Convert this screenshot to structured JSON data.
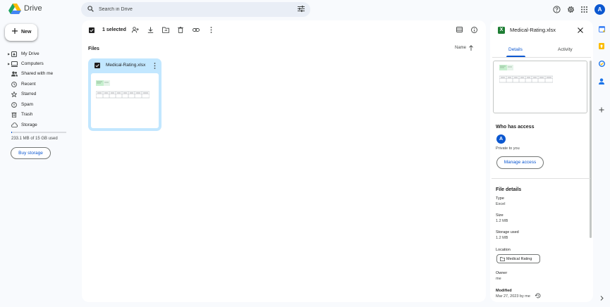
{
  "app": {
    "title": "Drive"
  },
  "search": {
    "placeholder": "Search in Drive"
  },
  "header": {
    "account_initial": "A"
  },
  "sidebar": {
    "new_label": "New",
    "items": [
      {
        "label": "My Drive",
        "icon": "my-drive-icon",
        "expandable": true
      },
      {
        "label": "Computers",
        "icon": "computer-icon",
        "expandable": true
      },
      {
        "label": "Shared with me",
        "icon": "people-icon",
        "expandable": false
      },
      {
        "label": "Recent",
        "icon": "clock-icon",
        "expandable": false
      },
      {
        "label": "Starred",
        "icon": "star-icon",
        "expandable": false
      },
      {
        "label": "Spam",
        "icon": "spam-icon",
        "expandable": false
      },
      {
        "label": "Trash",
        "icon": "trash-icon",
        "expandable": false
      },
      {
        "label": "Storage",
        "icon": "cloud-icon",
        "expandable": false
      }
    ],
    "storage_text": "233.1 MB of 15 GB used",
    "storage_fraction": 0.015,
    "buy_storage_label": "Buy storage"
  },
  "toolbar": {
    "selected_label": "1 selected"
  },
  "main": {
    "section_title": "Files",
    "sort_label": "Name",
    "files": [
      {
        "name": "Medical-Rating.xlsx",
        "selected": true
      }
    ]
  },
  "details": {
    "title": "Medical-Rating.xlsx",
    "file_type_badge": "X",
    "tabs": [
      "Details",
      "Activity"
    ],
    "active_tab": "Details",
    "access_heading": "Who has access",
    "access_avatar_initial": "A",
    "access_text": "Private to you",
    "manage_access_label": "Manage access",
    "file_details_heading": "File details",
    "type_label": "Type",
    "type_value": "Excel",
    "size_label": "Size",
    "size_value": "1.2 MB",
    "storage_used_label": "Storage used",
    "storage_used_value": "1.2 MB",
    "location_label": "Location",
    "location_value": "Medical Rating",
    "owner_label": "Owner",
    "owner_value": "me",
    "modified_label": "Modified",
    "modified_value": "Mar 27, 2023 by me"
  },
  "colors": {
    "accent": "#0b57d0",
    "selected_card": "#c2e7ff",
    "excel": "#1e7e34",
    "background": "#f8fafd"
  }
}
